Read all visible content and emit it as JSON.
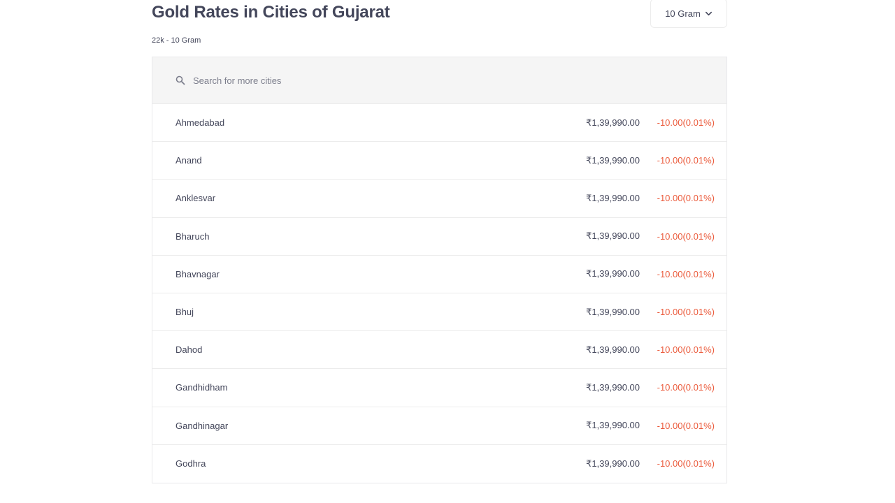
{
  "header": {
    "title": "Gold Rates in Cities of Gujarat",
    "subtitle": "22k - 10 Gram",
    "unit_selector": {
      "selected": "10 Gram",
      "icon": "chevron-down-icon"
    }
  },
  "search": {
    "placeholder": "Search for more cities",
    "value": "",
    "icon": "search-icon"
  },
  "colors": {
    "text": "#44475b",
    "negative_change": "#eb5b3c",
    "search_bg": "#f5f5f5",
    "divider": "#ececec"
  },
  "cities": [
    {
      "name": "Ahmedabad",
      "price": "₹1,39,990.00",
      "change": "-10.00(0.01%)"
    },
    {
      "name": "Anand",
      "price": "₹1,39,990.00",
      "change": "-10.00(0.01%)"
    },
    {
      "name": "Anklesvar",
      "price": "₹1,39,990.00",
      "change": "-10.00(0.01%)"
    },
    {
      "name": "Bharuch",
      "price": "₹1,39,990.00",
      "change": "-10.00(0.01%)"
    },
    {
      "name": "Bhavnagar",
      "price": "₹1,39,990.00",
      "change": "-10.00(0.01%)"
    },
    {
      "name": "Bhuj",
      "price": "₹1,39,990.00",
      "change": "-10.00(0.01%)"
    },
    {
      "name": "Dahod",
      "price": "₹1,39,990.00",
      "change": "-10.00(0.01%)"
    },
    {
      "name": "Gandhidham",
      "price": "₹1,39,990.00",
      "change": "-10.00(0.01%)"
    },
    {
      "name": "Gandhinagar",
      "price": "₹1,39,990.00",
      "change": "-10.00(0.01%)"
    },
    {
      "name": "Godhra",
      "price": "₹1,39,990.00",
      "change": "-10.00(0.01%)"
    }
  ]
}
